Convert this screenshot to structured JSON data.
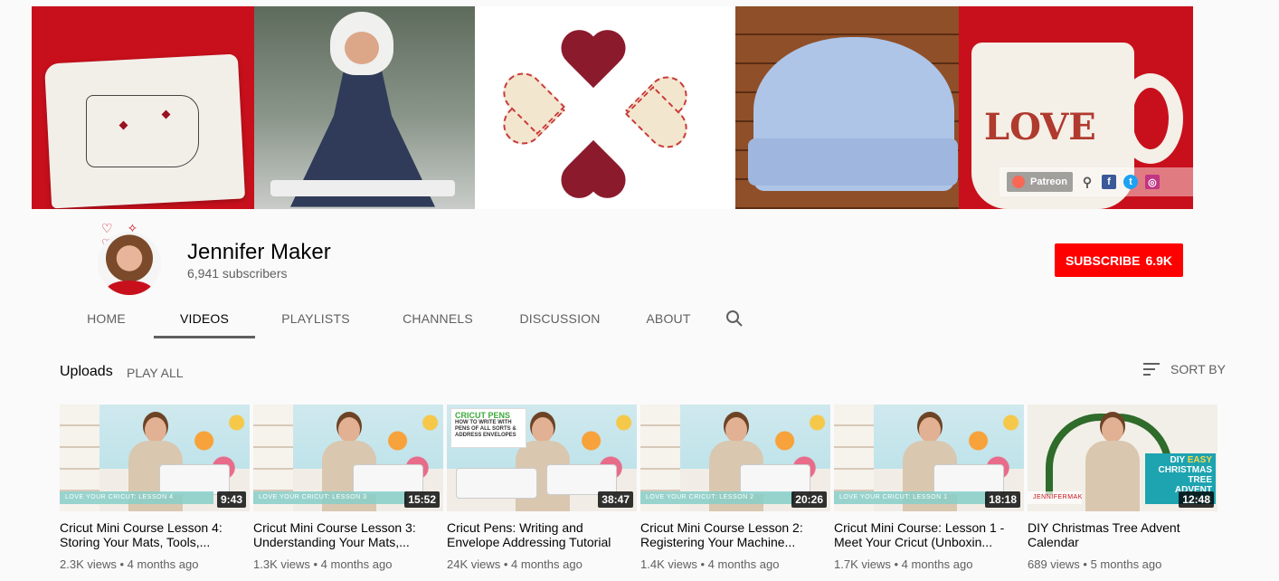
{
  "banner": {
    "mug_text": "LOVE",
    "social": {
      "patreon_label": "Patreon",
      "links": [
        {
          "name": "pinterest-icon",
          "glyph": "⚲"
        },
        {
          "name": "facebook-icon",
          "glyph": "f"
        },
        {
          "name": "twitter-icon",
          "glyph": "t"
        },
        {
          "name": "instagram-icon",
          "glyph": "◎"
        }
      ]
    }
  },
  "channel": {
    "name": "Jennifer Maker",
    "subscribers": "6,941 subscribers",
    "subscribe_label": "SUBSCRIBE",
    "subscribe_count": "6.9K"
  },
  "tabs": [
    {
      "label": "HOME",
      "active": false
    },
    {
      "label": "VIDEOS",
      "active": true
    },
    {
      "label": "PLAYLISTS",
      "active": false
    },
    {
      "label": "CHANNELS",
      "active": false
    },
    {
      "label": "DISCUSSION",
      "active": false
    },
    {
      "label": "ABOUT",
      "active": false
    }
  ],
  "uploads": {
    "heading": "Uploads",
    "play_all": "PLAY ALL",
    "sort_by": "SORT BY"
  },
  "videos": [
    {
      "title": "Cricut Mini Course Lesson 4: Storing Your Mats, Tools,...",
      "views": "2.3K views",
      "age": "4 months ago",
      "duration": "9:43",
      "strip": "LOVE YOUR CRICUT: LESSON 4"
    },
    {
      "title": "Cricut Mini Course Lesson 3: Understanding Your Mats,...",
      "views": "1.3K views",
      "age": "4 months ago",
      "duration": "15:52",
      "strip": "LOVE YOUR CRICUT: LESSON 3"
    },
    {
      "title": "Cricut Pens: Writing and Envelope Addressing Tutorial",
      "views": "24K views",
      "age": "4 months ago",
      "duration": "38:47",
      "strip": "",
      "label_title": "CRICUT PENS",
      "label_text": "HOW TO WRITE WITH PENS OF ALL SORTS & ADDRESS ENVELOPES"
    },
    {
      "title": "Cricut Mini Course Lesson 2: Registering Your Machine...",
      "views": "1.4K views",
      "age": "4 months ago",
      "duration": "20:26",
      "strip": "LOVE YOUR CRICUT: LESSON 2"
    },
    {
      "title": "Cricut Mini Course: Lesson 1 - Meet Your Cricut (Unboxin...",
      "views": "1.7K views",
      "age": "4 months ago",
      "duration": "18:18",
      "strip": "LOVE YOUR CRICUT: LESSON 1"
    },
    {
      "title": "DIY Christmas Tree Advent Calendar",
      "views": "689 views",
      "age": "5 months ago",
      "duration": "12:48",
      "strip": "JENNIFERMAKER",
      "diy_line1": "DIY",
      "diy_easy": "EASY",
      "diy_line2": "CHRISTMAS TREE",
      "diy_line3": "ADVENT CALE"
    }
  ],
  "colors": {
    "subscribe_red": "#ff0000",
    "background": "#fafafa",
    "text_primary": "#030303",
    "text_secondary": "#606060"
  }
}
